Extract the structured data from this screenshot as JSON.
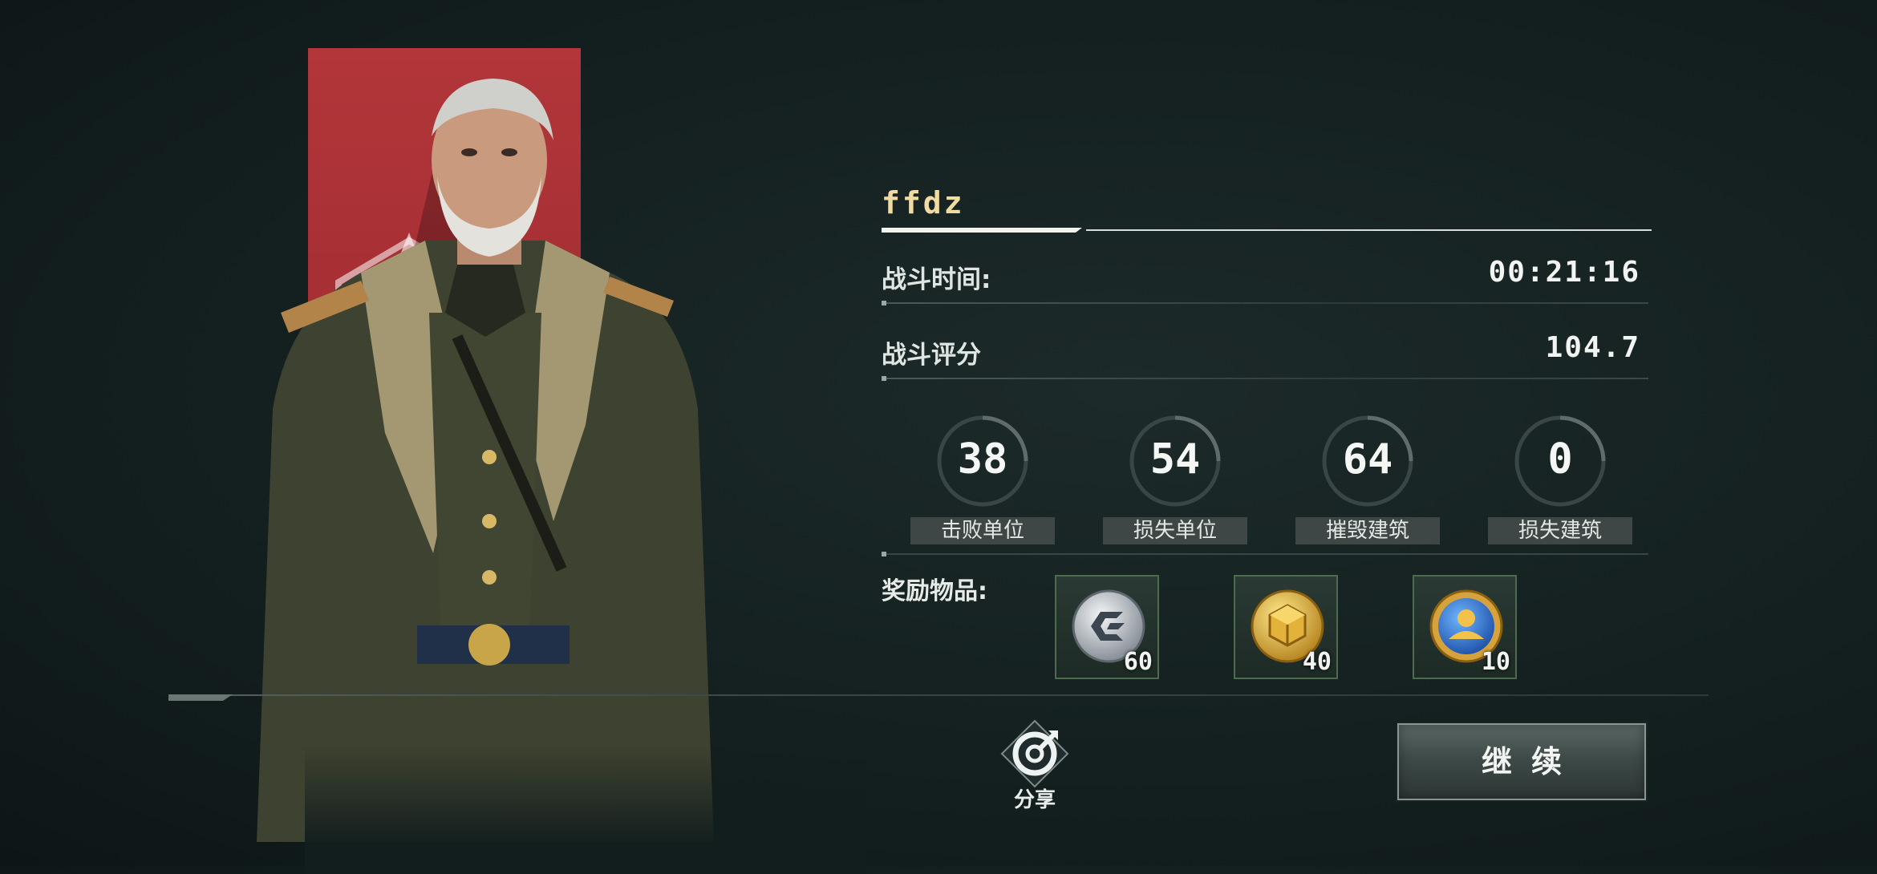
{
  "player": {
    "name": "ffdz"
  },
  "stats": {
    "battle_time": {
      "label": "战斗时间:",
      "value": "00:21:16"
    },
    "battle_score": {
      "label": "战斗评分",
      "value": "104.7"
    }
  },
  "counters": [
    {
      "value": "38",
      "label": "击败单位"
    },
    {
      "value": "54",
      "label": "损失单位"
    },
    {
      "value": "64",
      "label": "摧毁建筑"
    },
    {
      "value": "0",
      "label": "损失建筑"
    }
  ],
  "rewards": {
    "label": "奖励物品:",
    "items": [
      {
        "icon": "silver-coin-icon",
        "count": "60"
      },
      {
        "icon": "gold-coin-icon",
        "count": "40"
      },
      {
        "icon": "blue-badge-icon",
        "count": "10"
      }
    ]
  },
  "actions": {
    "share_label": "分享",
    "continue_label": "继续"
  },
  "colors": {
    "banner_red": "#b2363a",
    "name_gold": "#f0dca0",
    "reward_border": "#4d6b4e"
  }
}
